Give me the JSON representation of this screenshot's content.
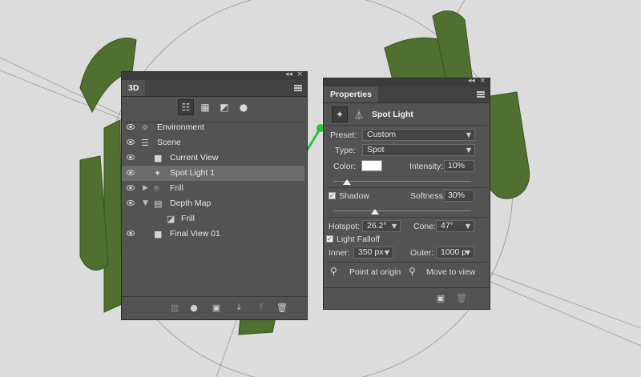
{
  "colors": {
    "canvas_bg": "#dcdcdc",
    "panel_bg": "#535353",
    "frill_green": "#4a6b2a",
    "light_color": "#ffffff",
    "selection": "#6b6b6b"
  },
  "panel_3d": {
    "tab_label": "3D",
    "collapse_glyph": "◂◂",
    "close_glyph": "×",
    "filter_icons": [
      "scene-filter-icon",
      "mesh-filter-icon",
      "material-filter-icon",
      "light-filter-icon"
    ],
    "layers": [
      {
        "name": "Environment",
        "icon": "environment-icon",
        "glyph": "☼"
      },
      {
        "name": "Scene",
        "icon": "scene-icon",
        "glyph": "☰"
      },
      {
        "name": "Current View",
        "icon": "camera-icon",
        "glyph": "■"
      },
      {
        "name": "Spot Light 1",
        "icon": "spot-light-icon",
        "glyph": "✦"
      },
      {
        "name": "Frill",
        "icon": "mesh-icon",
        "glyph": "⌾"
      },
      {
        "name": "Depth Map",
        "icon": "depth-map-icon",
        "glyph": "▤"
      },
      {
        "name": "Frill",
        "icon": "material-icon",
        "glyph": "◪"
      },
      {
        "name": "Final View 01",
        "icon": "camera-icon",
        "glyph": "■"
      }
    ],
    "bottom_icons": [
      "delete-mesh-icon",
      "new-light-icon",
      "render-icon",
      "move-to-ground-icon",
      "split-icon",
      "trash-icon"
    ]
  },
  "panel_props": {
    "tab_label": "Properties",
    "collapse_glyph": "◂◂",
    "close_glyph": "×",
    "header_title": "Spot Light",
    "preset_label": "Preset:",
    "preset_value": "Custom",
    "type_label": "Type:",
    "type_value": "Spot",
    "color_label": "Color:",
    "intensity_label": "Intensity:",
    "intensity_value": "10%",
    "intensity_fraction": 0.1,
    "shadow_label": "Shadow",
    "shadow_checked": true,
    "softness_label": "Softness:",
    "softness_value": "30%",
    "softness_fraction": 0.3,
    "hotspot_label": "Hotspot:",
    "hotspot_value": "26.2°",
    "cone_label": "Cone:",
    "cone_value": "47°",
    "light_falloff_label": "Light Falloff",
    "light_falloff_checked": true,
    "inner_label": "Inner:",
    "inner_value": "350 px",
    "outer_label": "Outer:",
    "outer_value": "1000 p",
    "point_origin_label": "Point at origin",
    "move_view_label": "Move to view",
    "check_glyph": "✓"
  }
}
